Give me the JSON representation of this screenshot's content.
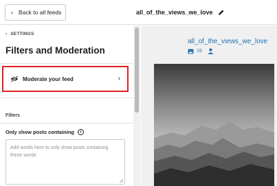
{
  "topbar": {
    "back_label": "Back to all feeds",
    "feed_name": "all_of_the_views_we_love"
  },
  "sidebar": {
    "breadcrumb": "SETTINGS",
    "title": "Filters and Moderation",
    "moderate_label": "Moderate your feed",
    "section_label": "Filters",
    "filter_field": {
      "label": "Only show posts containing",
      "placeholder": "Add words here to only show posts containing these words"
    }
  },
  "preview": {
    "account_name": "all_of_the_views_we_love",
    "media_count": "15"
  },
  "colors": {
    "accent_link": "#2271b1",
    "highlight_border": "#e0201f"
  }
}
